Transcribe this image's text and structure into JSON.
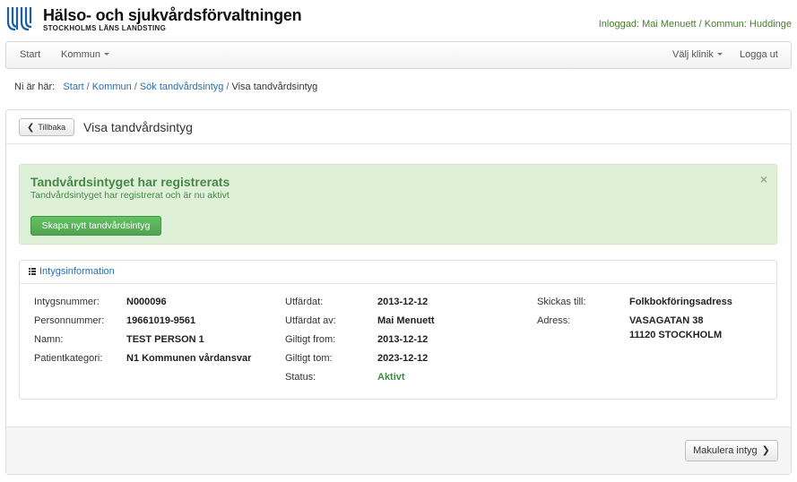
{
  "header": {
    "title": "Hälso- och sjukvårdsförvaltningen",
    "subtitle": "STOCKHOLMS LÄNS LANDSTING",
    "logged_in": "Inloggad: Mai Menuett / Kommun: Huddinge"
  },
  "nav": {
    "start": "Start",
    "kommun": "Kommun",
    "valj_klinik": "Välj klinik",
    "logout": "Logga ut"
  },
  "breadcrumb": {
    "prefix": "Ni är här:",
    "items": [
      "Start",
      "Kommun",
      "Sök tandvårdsintyg"
    ],
    "current": "Visa tandvårdsintyg"
  },
  "panel": {
    "back_label": "Tillbaka",
    "title": "Visa tandvårdsintyg"
  },
  "alert": {
    "title": "Tandvårdsintyget har registrerats",
    "text": "Tandvårdsintyget har registrerat och är nu aktivt",
    "close": "×",
    "button": "Skapa nytt tandvårdsintyg"
  },
  "info": {
    "heading": "Intygsinformation",
    "col1": [
      {
        "label": "Intygsnummer:",
        "value": "N000096"
      },
      {
        "label": "Personnummer:",
        "value": "19661019-9561"
      },
      {
        "label": "Namn:",
        "value": "TEST PERSON 1"
      },
      {
        "label": "Patientkategori:",
        "value": "N1 Kommunen vårdansvar"
      }
    ],
    "col2": [
      {
        "label": "Utfärdat:",
        "value": "2013-12-12"
      },
      {
        "label": "Utfärdat av:",
        "value": "Mai Menuett"
      },
      {
        "label": "Giltigt from:",
        "value": "2013-12-12"
      },
      {
        "label": "Giltigt tom:",
        "value": "2023-12-12"
      },
      {
        "label": "Status:",
        "value": "Aktivt"
      }
    ],
    "col3": [
      {
        "label": "Skickas till:",
        "value": "Folkbokföringsadress"
      },
      {
        "label": "Adress:",
        "value": "VASAGATAN 38",
        "value2": "11120 STOCKHOLM"
      }
    ]
  },
  "footer": {
    "void_button": "Makulera intyg"
  },
  "colors": {
    "brand_blue": "#1a5ea8",
    "link": "#2a6fb0",
    "success": "#468847",
    "success_bg": "#dff0d8",
    "button_green": "#51a351"
  }
}
